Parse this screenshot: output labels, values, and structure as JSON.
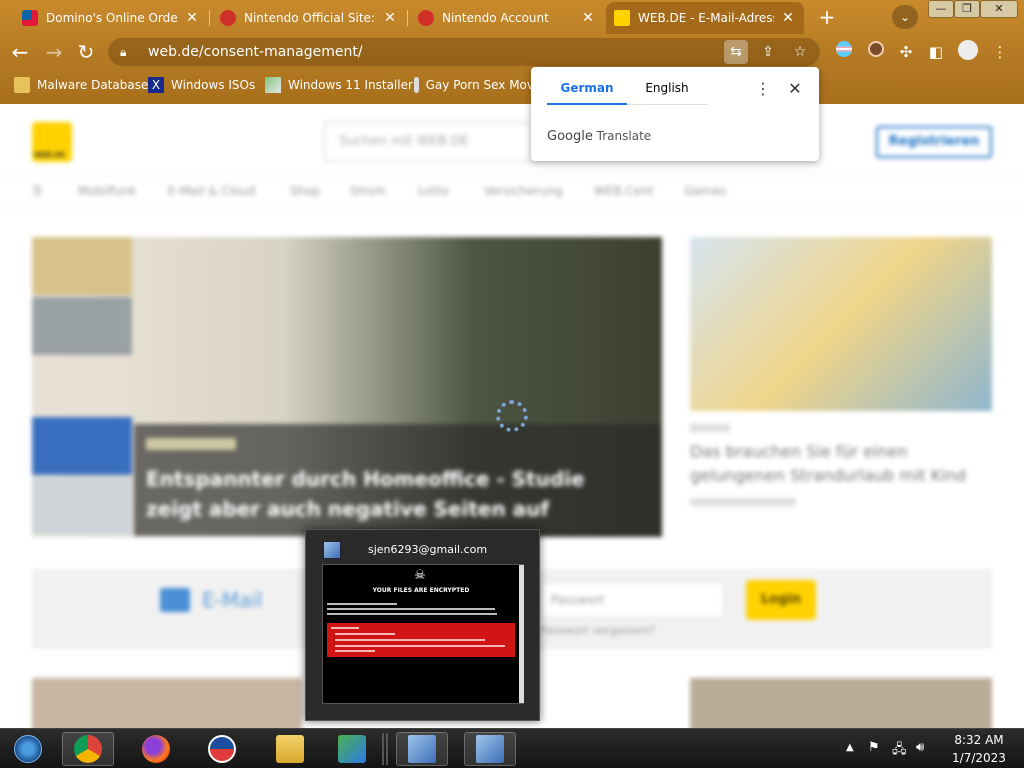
{
  "browser": {
    "tabs": [
      {
        "title": "Domino's Online Ordering",
        "active": false
      },
      {
        "title": "Nintendo Official Site: Co",
        "active": false
      },
      {
        "title": "Nintendo Account",
        "active": false
      },
      {
        "title": "WEB.DE - E-Mail-Adresse",
        "active": true
      }
    ],
    "url": "web.de/consent-management/",
    "bookmarks": [
      "Malware Database",
      "Windows ISOs",
      "Windows 11 Installer",
      "Gay Porn Sex Mov"
    ]
  },
  "translate_popup": {
    "lang_source": "German",
    "lang_target": "English",
    "brand_google": "Google",
    "brand_translate": "Translate"
  },
  "page": {
    "search_placeholder": "Suchen mit WEB.DE",
    "register_label": "Registrieren",
    "nav_items": [
      "Mobilfunk",
      "E-Mail & Cloud",
      "Shop",
      "Strom",
      "Lotto",
      "Versicherung",
      "WEB.Cent",
      "Games"
    ],
    "hero_headline": "Entspannter durch Homeoffice - Studie zeigt aber auch negative Seiten auf",
    "side_headline": "Das brauchen Sie für einen gelungenen Strandurlaub mit Kind",
    "mail_label": "E-Mail",
    "password_placeholder": "Passwort",
    "login_label": "Login",
    "forgot_label": "Passwort vergessen?"
  },
  "ransom_window": {
    "title": "sjen6293@gmail.com",
    "heading": "YOUR FILES ARE ENCRYPTED"
  },
  "taskbar": {
    "time": "8:32 AM",
    "date": "1/7/2023"
  },
  "colors": {
    "frame": "#b47a23",
    "accent_yellow": "#ffd200",
    "register_blue": "#1b72c2",
    "translate_blue": "#1a73e8",
    "ransom_red": "#d11414"
  }
}
